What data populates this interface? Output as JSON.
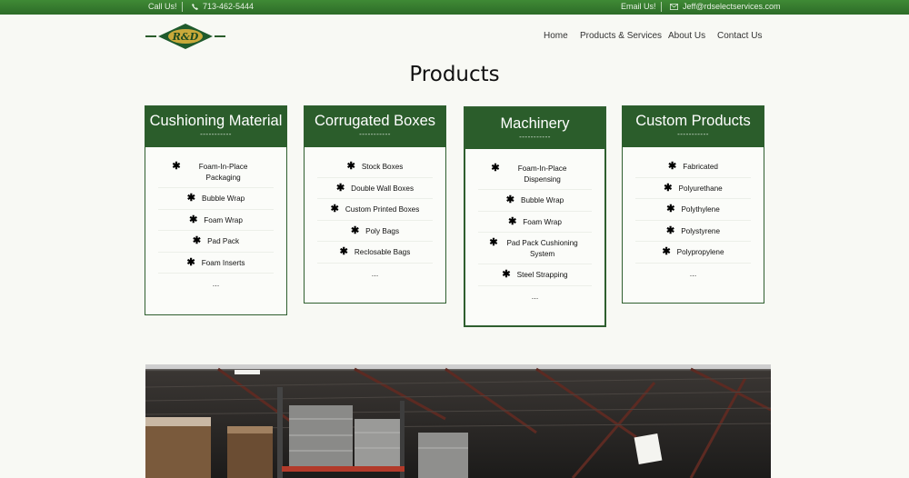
{
  "topbar": {
    "call_label": "Call Us!",
    "phone": "713-462-5444",
    "email_label": "Email Us!",
    "email": "Jeff@rdselectservices.com"
  },
  "logo": {
    "text": "R&D"
  },
  "nav": {
    "items": [
      "Home",
      "Products & Services",
      "About Us",
      "Contact Us"
    ]
  },
  "main": {
    "title": "Products"
  },
  "cards": [
    {
      "title": "Cushioning Material",
      "divider": "-----------",
      "items": [
        "Foam-In-Place Packaging",
        "Bubble Wrap",
        "Foam Wrap",
        "Pad Pack",
        "Foam Inserts"
      ],
      "more": "..."
    },
    {
      "title": "Corrugated Boxes",
      "divider": "-----------",
      "items": [
        "Stock Boxes",
        "Double Wall Boxes",
        "Custom Printed Boxes",
        "Poly Bags",
        "Reclosable Bags"
      ],
      "more": "..."
    },
    {
      "title": "Machinery",
      "divider": "-----------",
      "items": [
        "Foam-In-Place Dispensing",
        "Bubble Wrap",
        "Foam Wrap",
        "Pad Pack Cushioning System",
        "Steel Strapping"
      ],
      "more": "..."
    },
    {
      "title": "Custom Products",
      "divider": "-----------",
      "items": [
        "Fabricated",
        "Polyurethane",
        "Polythylene",
        "Polystyrene",
        "Polypropylene"
      ],
      "more": "..."
    }
  ],
  "colors": {
    "brand_green": "#2b5d2b",
    "topbar_green": "#3a7f32",
    "logo_gold": "#c9a93a"
  },
  "icons": {
    "phone": "phone-icon",
    "email": "envelope-icon",
    "bullet": "asterisk-icon"
  }
}
